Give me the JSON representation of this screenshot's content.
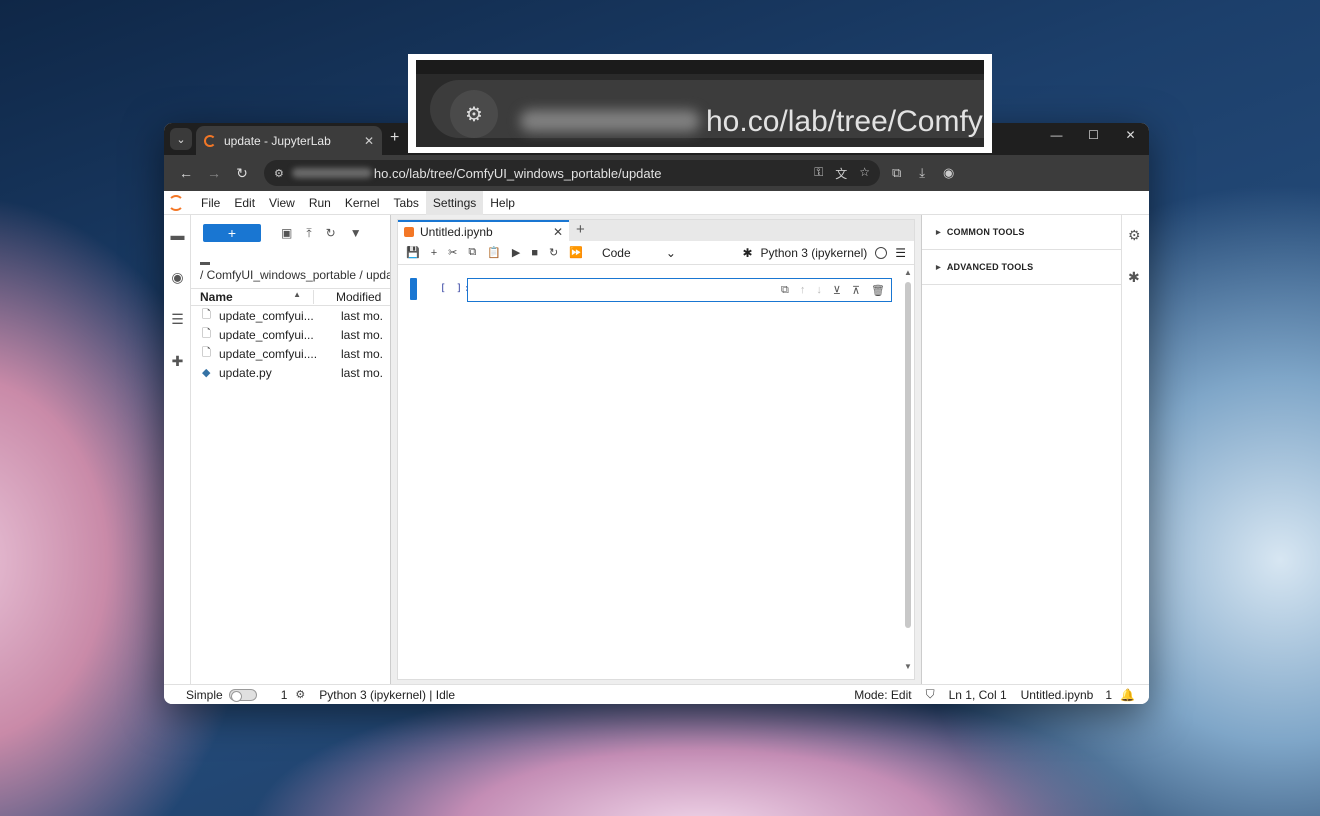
{
  "browser": {
    "tab_title": "update - JupyterLab",
    "new_tab": "+",
    "tab_close": "✕",
    "window_controls": [
      "—",
      "☐",
      "✕"
    ],
    "url_visible": "ho.co/lab/tree/ComfyUI_windows_portable/update",
    "zoom_url": "ho.co/lab/tree/ComfyUI_"
  },
  "menubar": {
    "items": [
      "File",
      "Edit",
      "View",
      "Run",
      "Kernel",
      "Tabs",
      "Settings",
      "Help"
    ]
  },
  "filebrowser": {
    "new_label": "+",
    "breadcrumb": "/ ComfyUI_windows_portable / update",
    "col_name": "Name",
    "col_modified": "Modified",
    "files": [
      {
        "name": "update_comfyui...",
        "modified": "last mo.",
        "icon": "file-icon"
      },
      {
        "name": "update_comfyui...",
        "modified": "last mo.",
        "icon": "file-icon"
      },
      {
        "name": "update_comfyui....",
        "modified": "last mo.",
        "icon": "file-icon"
      },
      {
        "name": "update.py",
        "modified": "last mo.",
        "icon": "python-icon"
      }
    ]
  },
  "notebook": {
    "tab_title": "Untitled.ipynb",
    "cell_type": "Code",
    "kernel_name": "Python 3 (ipykernel)",
    "cell_prompt": "[ ]:"
  },
  "right_sidebar": {
    "sections": [
      "COMMON TOOLS",
      "ADVANCED TOOLS"
    ]
  },
  "statusbar": {
    "mode_label": "Simple",
    "terminals": "1",
    "kernel_status": "Python 3 (ipykernel) | Idle",
    "mode": "Mode: Edit",
    "position": "Ln 1, Col 1",
    "file": "Untitled.ipynb",
    "notifications": "1"
  },
  "colors": {
    "accent": "#1976d2",
    "jupyter_orange": "#f37726",
    "browser_chrome": "#3c3c3c"
  }
}
